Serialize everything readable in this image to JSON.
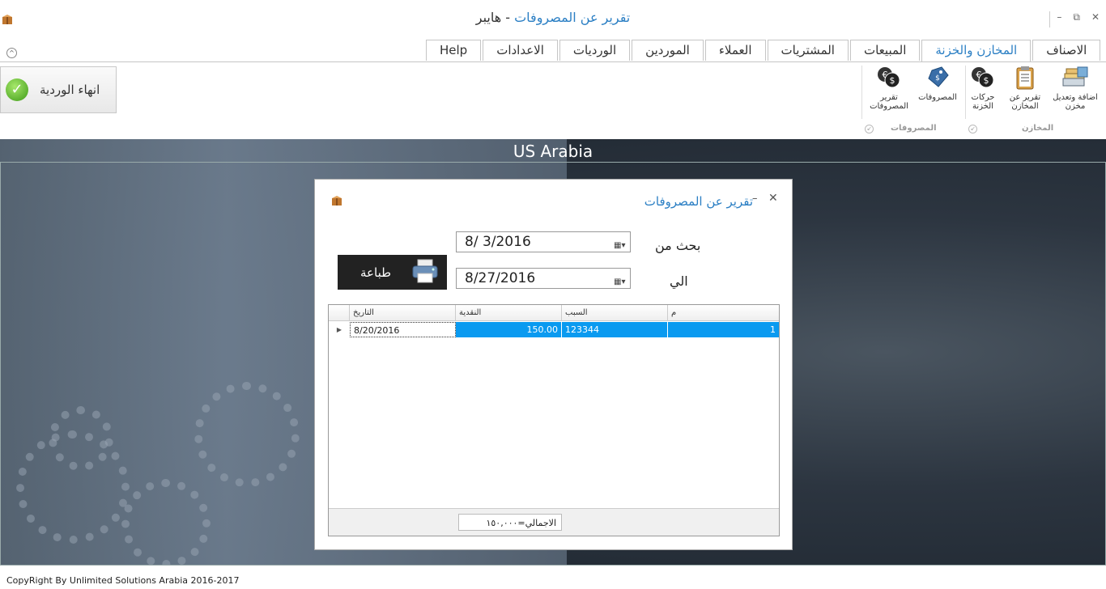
{
  "window": {
    "title_main": "تقرير عن المصروفات",
    "title_sep": " - ",
    "title_suffix": "هايبر"
  },
  "tabs": [
    {
      "label": "Help",
      "active": false
    },
    {
      "label": "الاعدادات",
      "active": false
    },
    {
      "label": "الورديات",
      "active": false
    },
    {
      "label": "الموردين",
      "active": false
    },
    {
      "label": "العملاء",
      "active": false
    },
    {
      "label": "المشتريات",
      "active": false
    },
    {
      "label": "المبيعات",
      "active": false
    },
    {
      "label": "المخازن والخزنة",
      "active": true
    },
    {
      "label": "الاصناف",
      "active": false
    }
  ],
  "ribbon": {
    "end_shift_label": "انهاء الوردية",
    "buttons": {
      "add_edit_store": "اضافة وتعديل مخزن",
      "stores_report": "تقرير عن المخازن",
      "treasury_moves": "حركات الخزنة",
      "expenses": "المصروفات",
      "expenses_report": "تقرير المصروفات"
    },
    "groups": {
      "stores": "المخازن",
      "expenses": "المصروفات"
    }
  },
  "banner": "US Arabia",
  "dialog": {
    "title": "تقرير عن المصروفات",
    "from_label": "بحث من",
    "to_label": "الي",
    "from_date": "8/  3/2016",
    "to_date": "8/27/2016",
    "print_label": "طباعة",
    "grid": {
      "columns": [
        "م",
        "السبب",
        "النقدية",
        "التاريخ"
      ],
      "rows": [
        {
          "no": "1",
          "reason": "123344",
          "cash": "150.00",
          "date": "8/20/2016"
        }
      ],
      "total": "الاجمالي=١٥٠,٠٠٠"
    }
  },
  "footer": "CopyRight By Unlimited Solutions Arabia 2016-2017",
  "colors": {
    "accent": "#2b7fc4",
    "selection": "#0a9af0"
  }
}
